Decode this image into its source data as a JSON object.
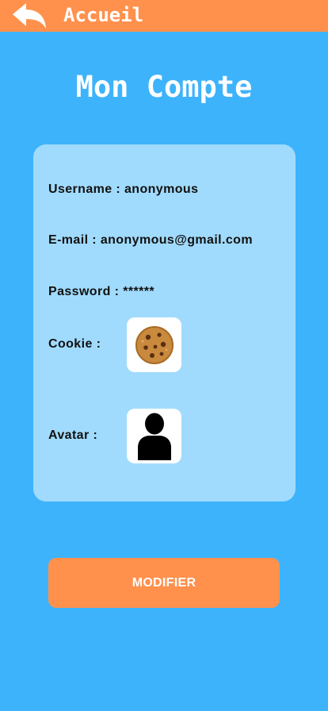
{
  "topbar": {
    "back_icon": "reply-arrow-icon",
    "back_label": "Accueil",
    "color": "#ff914d"
  },
  "page": {
    "title": "Mon Compte",
    "background": "#3db3fc"
  },
  "account": {
    "username_label": "Username : anonymous",
    "email_label": "E-mail : anonymous@gmail.com",
    "password_label": "Password : ******",
    "cookie_label": "Cookie :",
    "cookie_icon": "cookie-icon",
    "avatar_label": "Avatar :",
    "avatar_icon": "person-silhouette-icon"
  },
  "actions": {
    "modify_label": "MODIFIER",
    "modify_color": "#ff914d"
  }
}
